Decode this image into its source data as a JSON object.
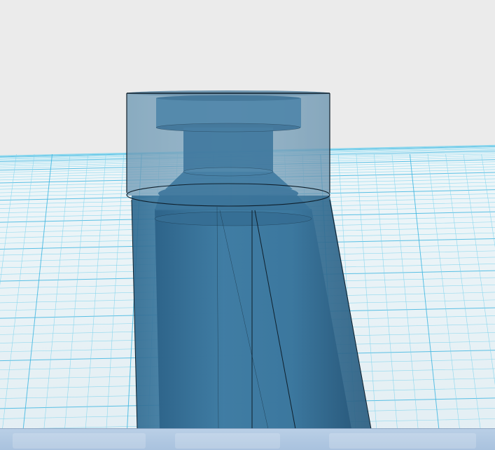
{
  "app": {
    "view": "3d-model-viewport",
    "model": "translucent-cylindrical-part"
  },
  "colors": {
    "background": "#ebebeb",
    "grid_plane": "#e6f3f8",
    "grid_minor": "#7fd4ec",
    "grid_major": "#3fb6e0",
    "model_body": "#3f7fa6",
    "model_body_dark": "#285a7c",
    "model_outline": "#0e1e2a",
    "bottom_bar": "#b4cbe3"
  },
  "scene": {
    "grid": true,
    "perspective": true
  }
}
